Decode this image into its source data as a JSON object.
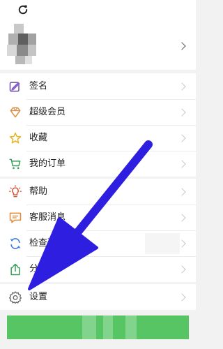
{
  "header": {
    "refresh_icon": "refresh-icon"
  },
  "profile": {
    "avatar": "avatar-pixelated",
    "chevron": "chevron-right-icon"
  },
  "menu_group_1": [
    {
      "label": "签名",
      "icon": "signature-icon",
      "color": "#6b4fa0"
    },
    {
      "label": "超级会员",
      "icon": "diamond-icon",
      "color": "#d8924a"
    },
    {
      "label": "收藏",
      "icon": "star-icon",
      "color": "#e6b61e"
    },
    {
      "label": "我的订单",
      "icon": "cart-icon",
      "color": "#3a9d5b"
    }
  ],
  "menu_group_2": [
    {
      "label": "帮助",
      "icon": "lightbulb-icon",
      "color": "#d8543a"
    },
    {
      "label": "客服消息",
      "icon": "message-icon",
      "color": "#e08a3a"
    },
    {
      "label": "检查更新",
      "icon": "sync-icon",
      "color": "#3b7de0"
    },
    {
      "label": "分享应",
      "icon": "share-icon",
      "color": "#3a9d5b"
    }
  ],
  "menu_group_3": [
    {
      "label": "设置",
      "icon": "settings-gear-icon",
      "color": "#666666"
    }
  ],
  "annotation": {
    "arrow_color": "#2e1fe0"
  },
  "bottom_banner": {
    "color": "#58c565"
  }
}
